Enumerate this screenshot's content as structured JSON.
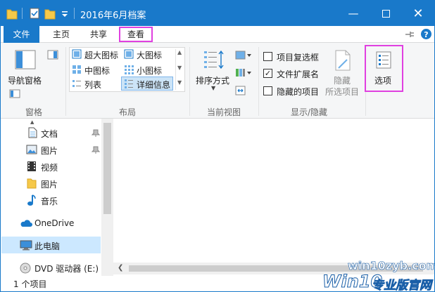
{
  "window": {
    "title": "2016年6月档案"
  },
  "menu": {
    "file": "文件",
    "home": "主页",
    "share": "共享",
    "view": "查看"
  },
  "ribbon": {
    "panes": {
      "nav_pane": "导航窗格",
      "group": "窗格"
    },
    "layout": {
      "extra_large": "超大图标",
      "large": "大图标",
      "medium": "中图标",
      "small": "小图标",
      "list": "列表",
      "details": "详细信息",
      "group": "布局"
    },
    "current_view": {
      "sort": "排序方式",
      "group": "当前视图"
    },
    "show_hide": {
      "item_checkboxes": "项目复选框",
      "file_ext": "文件扩展名",
      "hidden_items": "隐藏的项目",
      "hide_selected_1": "隐藏",
      "hide_selected_2": "所选项目",
      "group": "显示/隐藏"
    },
    "options": "选项"
  },
  "nav": {
    "items": [
      {
        "label": "文档",
        "icon": "document-icon",
        "pinned": true
      },
      {
        "label": "图片",
        "icon": "picture-icon",
        "pinned": true
      },
      {
        "label": "视频",
        "icon": "video-icon",
        "pinned": false
      },
      {
        "label": "图片",
        "icon": "folder-icon",
        "pinned": false
      },
      {
        "label": "音乐",
        "icon": "music-icon",
        "pinned": false
      },
      {
        "label": "OneDrive",
        "icon": "cloud-icon",
        "pinned": false
      },
      {
        "label": "此电脑",
        "icon": "computer-icon",
        "pinned": false
      },
      {
        "label": "DVD 驱动器 (E:) S",
        "icon": "dvd-icon",
        "pinned": false
      }
    ]
  },
  "status": {
    "count": "1 个项目"
  },
  "watermark": {
    "url": "win10zyb.com",
    "brand_a": "Win10",
    "brand_b": "专业版官网"
  },
  "colors": {
    "accent": "#1979ca",
    "highlight": "#e040e0"
  }
}
